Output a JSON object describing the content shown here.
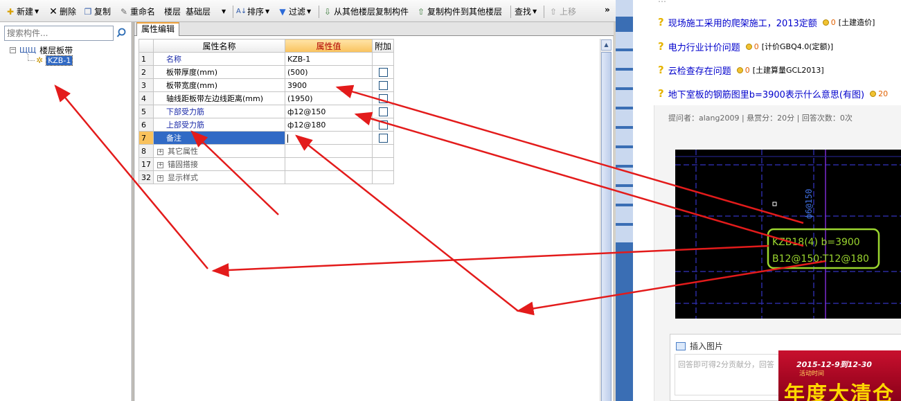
{
  "toolbar": {
    "new": "新建",
    "delete": "删除",
    "copy": "复制",
    "rename": "重命名",
    "layer_label": "楼层",
    "layer_value": "基础层",
    "sort": "排序",
    "filter": "过滤",
    "copy_from_floor": "从其他楼层复制构件",
    "copy_to_floor": "复制构件到其他楼层",
    "find": "查找",
    "move_up": "上移",
    "more": "»"
  },
  "tree": {
    "search_placeholder": "搜索构件...",
    "root": "楼层板带",
    "child": "KZB-1"
  },
  "editor": {
    "tab": "属性编辑",
    "columns": [
      "属性名称",
      "属性值",
      "附加"
    ],
    "rows": [
      {
        "num": "1",
        "name": "名称",
        "value": "KZB-1",
        "style": "blue",
        "check": false
      },
      {
        "num": "2",
        "name": "板带厚度(mm)",
        "value": "(500)",
        "style": "black",
        "check": true
      },
      {
        "num": "3",
        "name": "板带宽度(mm)",
        "value": "3900",
        "style": "black",
        "check": true
      },
      {
        "num": "4",
        "name": "轴线距板带左边线距离(mm)",
        "value": "(1950)",
        "style": "black",
        "check": true
      },
      {
        "num": "5",
        "name": "下部受力筋",
        "value": "ф12@150",
        "style": "blue",
        "check": true
      },
      {
        "num": "6",
        "name": "上部受力筋",
        "value": "ф12@180",
        "style": "blue",
        "check": true
      },
      {
        "num": "7",
        "name": "备注",
        "value": "",
        "style": "selected",
        "check": true
      },
      {
        "num": "8",
        "name": "其它属性",
        "value": "",
        "style": "group",
        "check": false
      },
      {
        "num": "17",
        "name": "锚固搭接",
        "value": "",
        "style": "group",
        "check": false
      },
      {
        "num": "32",
        "name": "显示样式",
        "value": "",
        "style": "group",
        "check": false
      }
    ]
  },
  "web": {
    "questions": [
      {
        "title": "现场施工采用的爬架施工，2013定额",
        "count": "0",
        "tag": "[土建造价]"
      },
      {
        "title": "电力行业计价问题",
        "count": "0",
        "tag": "[计价GBQ4.0(定额)]"
      },
      {
        "title": "云检查存在问题",
        "count": "0",
        "tag": "[土建算量GCL2013]"
      },
      {
        "title": "地下室板的钢筋图里b=3900表示什么意思(有图)",
        "count": "20",
        "tag": ""
      }
    ],
    "meta": "提问者：alang2009  |  悬赏分：20分  |  回答次数：0次",
    "cad": {
      "label_line1": "KZB18(4) b=3900",
      "label_line2": "B12@150;T12@180",
      "vertical_label": "ф6@150"
    },
    "insert_image": "插入图片",
    "answer_placeholder": "回答即可得2分贡献分，回答",
    "ad": {
      "date": "2015-12-9到12-30",
      "sub": "活动时间",
      "big": "年度大清仓"
    }
  },
  "colors": {
    "arrow": "#e31b1b",
    "selection": "#316ac5",
    "cad_green": "#9bd62f",
    "cad_blue": "#2a2aa0",
    "question_mark": "#e6b400"
  }
}
